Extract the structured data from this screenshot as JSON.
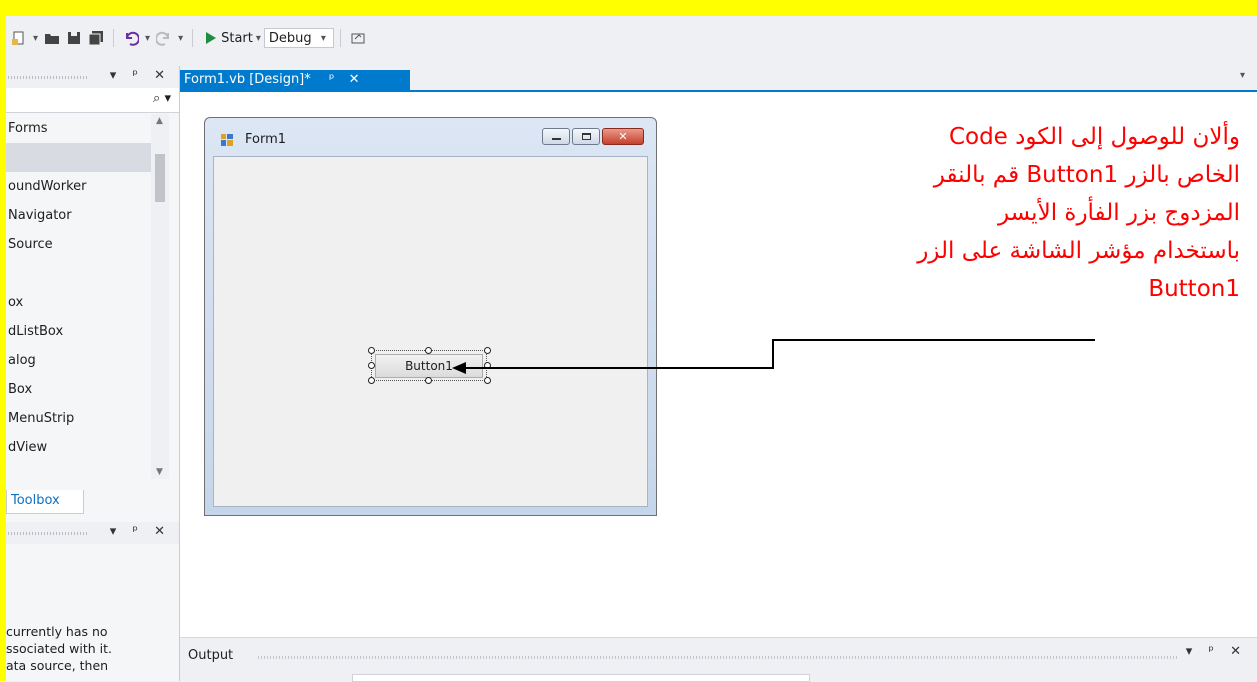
{
  "toolbar": {
    "start_label": "Start",
    "start_dropdown": "▾",
    "config_value": "Debug",
    "config_dropdown": "▾"
  },
  "toolbox_panel": {
    "pin": "▾ ᵖ ✕",
    "search_icon": "⌕ ▾",
    "items": [
      "Forms",
      "",
      "oundWorker",
      "Navigator",
      "Source",
      "",
      "ox",
      "dListBox",
      "alog",
      "Box",
      "MenuStrip",
      "dView"
    ],
    "selected_index": 1,
    "tab_label": "Toolbox"
  },
  "datasources_panel": {
    "pin": "▾ ᵖ ✕",
    "lines": [
      "currently has no",
      "ssociated with it.",
      "ata source, then"
    ]
  },
  "document": {
    "tab_label": "Form1.vb [Design]*",
    "tab_pin": "ᵖ",
    "tab_close": "✕",
    "tab_overflow": "▾"
  },
  "form": {
    "title": "Form1",
    "button_text": "Button1"
  },
  "annotation": {
    "lines": [
      "وألان للوصول إلى الكود     Code",
      "الخاص بالزر  Button1 قم بالنقر",
      "المزدوج بزر الفأرة الأيسر",
      "باستخدام مؤشر الشاشة على الزر",
      "Button1"
    ],
    "color": "#ff0000"
  },
  "output_panel": {
    "label": "Output",
    "pin": "▾ ᵖ ✕"
  },
  "colors": {
    "frame_yellow": "#ffff00",
    "accent_blue": "#007acc"
  }
}
